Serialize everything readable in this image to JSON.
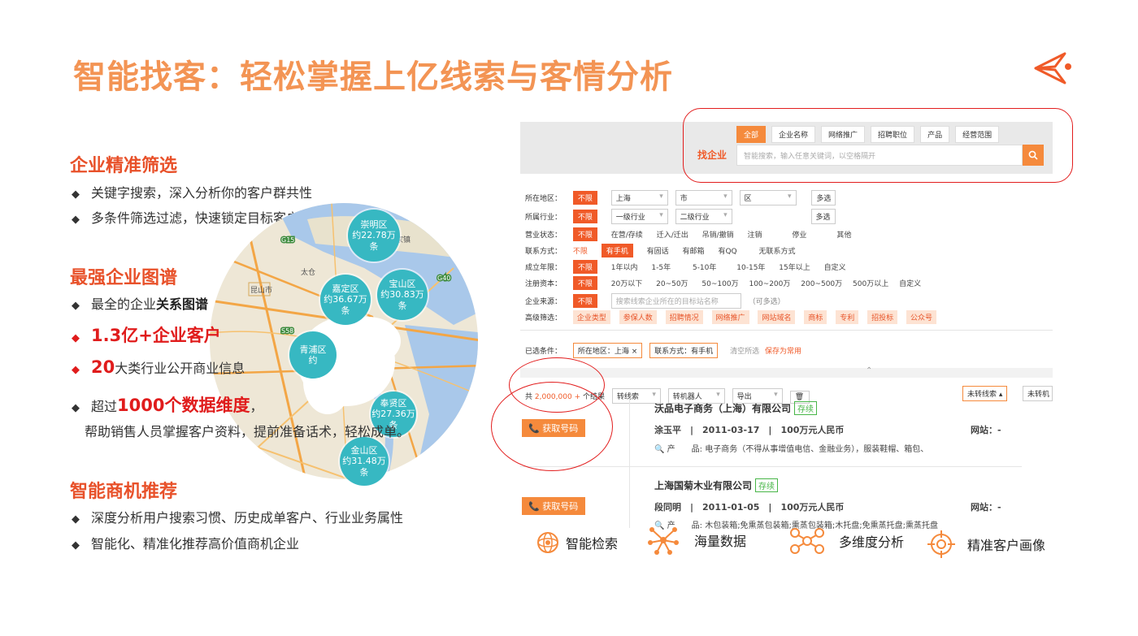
{
  "title": "智能找客：轻松掌握上亿线索与客情分析",
  "colors": {
    "title": "#f39454",
    "section": "#e8512a",
    "red": "#e01c1c",
    "accent": "#f58a3c",
    "teal": "#37b8c2"
  },
  "sections": {
    "s1": {
      "title": "企业精准筛选",
      "b1": "关键字搜索，深入分析你的客户群共性",
      "b2": "多条件筛选过滤，快速锁定目标客户"
    },
    "s2": {
      "title": "最强企业图谱",
      "b1a": "最全的企业",
      "b1b": "关系图谱",
      "b2": "1.3亿+企业客户",
      "b3a": "20",
      "b3b": "大类行业公开商业信息",
      "b4a": "超过",
      "b4b": "1000个数据维度",
      "b4c": "，",
      "b4d": "帮助销售人员掌握客户资料，提前准备话术，轻松成单。"
    },
    "s3": {
      "title": "智能商机推荐",
      "b1": "深度分析用户搜索习惯、历史成单客户、行业业务属性",
      "b2": "智能化、精准化推荐高价值商机企业"
    }
  },
  "map": {
    "districts": [
      {
        "name": "崇明区",
        "value": "约22.78万",
        "unit": "条"
      },
      {
        "name": "嘉定区",
        "value": "约36.67万",
        "unit": "条"
      },
      {
        "name": "宝山区",
        "value": "约30.83万",
        "unit": "条"
      },
      {
        "name": "青浦区",
        "value": "约",
        "unit": ""
      },
      {
        "name": "奉贤区",
        "value": "约27.36万",
        "unit": "条"
      },
      {
        "name": "金山区",
        "value": "约31.48万",
        "unit": "条"
      }
    ],
    "labels": {
      "g15": "G15",
      "g40": "G40",
      "s58": "S58",
      "taicang": "太仓",
      "kunshan": "昆山市",
      "haimen": "海门",
      "chenjia": "陈家镇"
    }
  },
  "screen": {
    "tabs": [
      "全部",
      "企业名称",
      "网络推广",
      "招聘职位",
      "产品",
      "经营范围"
    ],
    "find_label": "找企业",
    "search_placeholder": "智能搜索，输入任意关键词，以空格隔开",
    "filters": {
      "region": {
        "label": "所在地区：",
        "any": "不限",
        "province": "上海",
        "city": "市",
        "district": "区",
        "multi": "多选"
      },
      "industry": {
        "label": "所属行业：",
        "any": "不限",
        "l1": "一级行业",
        "l2": "二级行业",
        "multi": "多选"
      },
      "status": {
        "label": "营业状态：",
        "any": "不限",
        "opts": [
          "在营/存续",
          "迁入/迁出",
          "吊销/撤销",
          "注销",
          "停业",
          "其他"
        ]
      },
      "contact": {
        "label": "联系方式：",
        "any": "不限",
        "opts": [
          "有手机",
          "有固话",
          "有邮箱",
          "有QQ",
          "无联系方式"
        ]
      },
      "years": {
        "label": "成立年限：",
        "any": "不限",
        "opts": [
          "1年以内",
          "1-5年",
          "5-10年",
          "10-15年",
          "15年以上",
          "自定义"
        ]
      },
      "capital": {
        "label": "注册资本：",
        "any": "不限",
        "opts": [
          "20万以下",
          "20~50万",
          "50~100万",
          "100~200万",
          "200~500万",
          "500万以上",
          "自定义"
        ]
      },
      "source": {
        "label": "企业来源：",
        "any": "不限",
        "placeholder": "搜索线索企业所在的目标站名称",
        "hint": "（可多选）"
      },
      "advanced": {
        "label": "高级筛选：",
        "opts": [
          "企业类型",
          "参保人数",
          "招聘情况",
          "网络推广",
          "网站域名",
          "商标",
          "专利",
          "招投标",
          "公众号"
        ]
      }
    },
    "selected": {
      "label": "已选条件：",
      "chip1": "所在地区：上海",
      "chip2": "联系方式：有手机",
      "clear": "清空所选",
      "save": "保存为常用"
    },
    "toolbar": {
      "count_prefix": "共",
      "count": "2,000,000",
      "count_suffix": "个结果",
      "convert": "转线索",
      "robot": "转机器人",
      "export": "导出",
      "sort1": "未转线索",
      "sort2": "未转机"
    },
    "results": [
      {
        "company": "沃品电子商务（上海）有限公司",
        "status": "存续",
        "person": "涂玉平",
        "date": "2011-03-17",
        "capital": "100万元人民币",
        "site": "网站：-",
        "products": "产　　品: 电子商务（不得从事增值电信、金融业务），服装鞋帽、箱包、",
        "btn": "获取号码"
      },
      {
        "company": "上海国菊木业有限公司",
        "status": "存续",
        "person": "段同明",
        "date": "2011-01-05",
        "capital": "100万元人民币",
        "site": "网站：-",
        "products": "产　　品: 木包装箱;免熏蒸包装箱;熏蒸包装箱;木托盘;免熏蒸托盘;熏蒸托盘",
        "btn": "获取号码"
      }
    ]
  },
  "features": [
    "智能检索",
    "海量数据",
    "多维度分析",
    "精准客户画像"
  ]
}
